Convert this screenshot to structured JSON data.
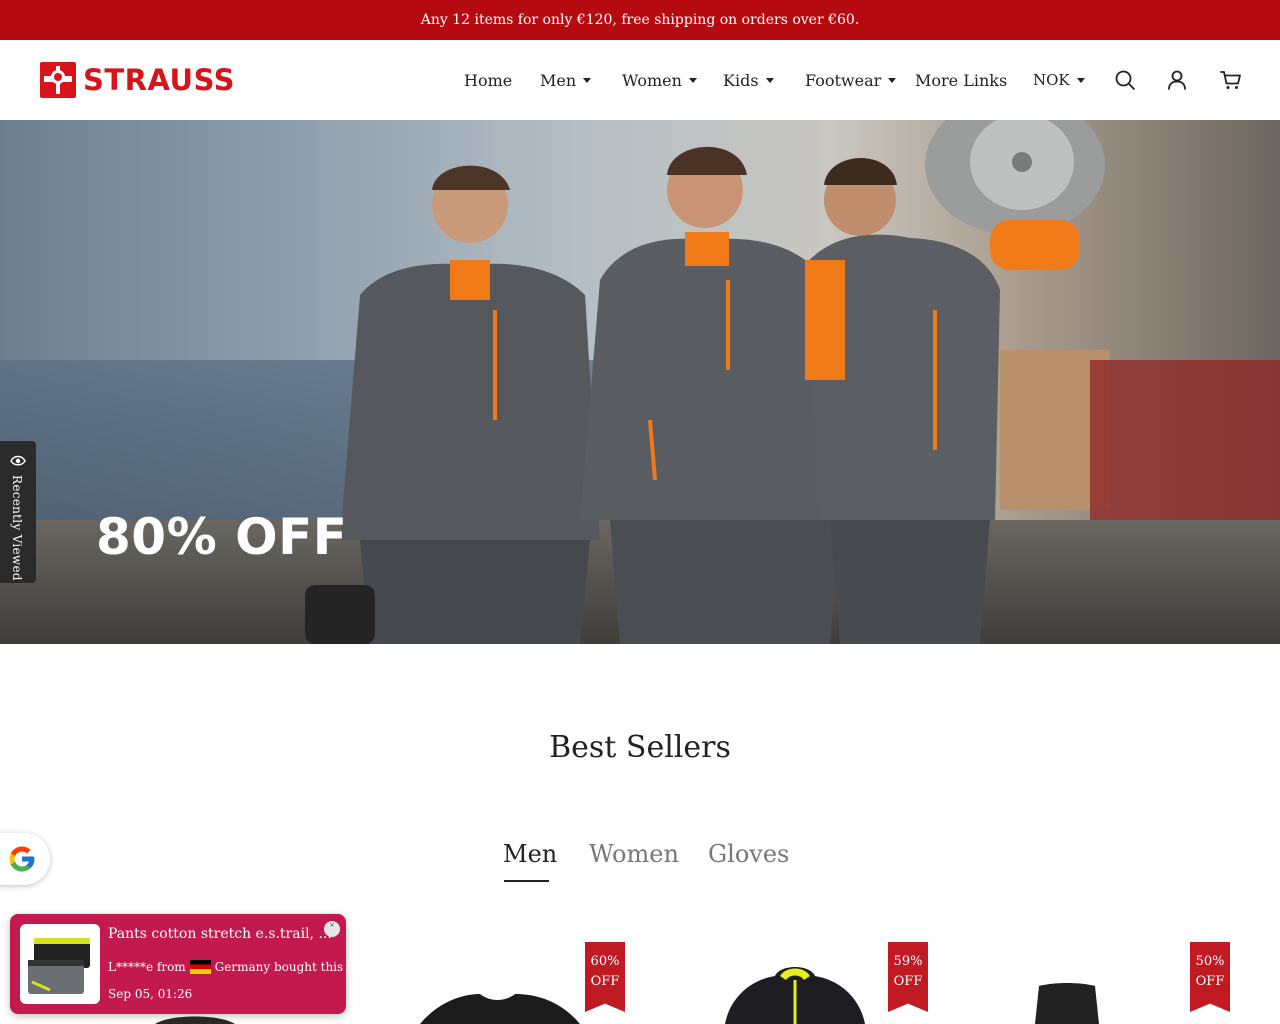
{
  "announcement": "Any 12 items for only €120, free shipping on orders over €60.",
  "brand": {
    "name": "STRAUSS",
    "color": "#d8141b"
  },
  "nav": {
    "items": [
      {
        "label": "Home",
        "has_dropdown": false
      },
      {
        "label": "Men",
        "has_dropdown": true
      },
      {
        "label": "Women",
        "has_dropdown": true
      },
      {
        "label": "Kids",
        "has_dropdown": true
      },
      {
        "label": "Footwear",
        "has_dropdown": true
      },
      {
        "label": "More Links",
        "has_dropdown": false
      }
    ],
    "currency": "NOK",
    "icons": [
      "search-icon",
      "account-icon",
      "cart-icon"
    ]
  },
  "hero": {
    "headline": "80% OFF"
  },
  "recently_viewed": {
    "label": "Recently Viewed"
  },
  "best_sellers": {
    "title": "Best Sellers",
    "tabs": [
      {
        "label": "Men",
        "active": true
      },
      {
        "label": "Women",
        "active": false
      },
      {
        "label": "Gloves",
        "active": false
      }
    ],
    "products": [
      {
        "discount_pct": "60%",
        "discount_suffix": "OFF"
      },
      {
        "discount_pct": "59%",
        "discount_suffix": "OFF"
      },
      {
        "discount_pct": "50%",
        "discount_suffix": "OFF"
      }
    ]
  },
  "purchase_popup": {
    "product": "Pants cotton stretch e.s.trail, ...",
    "buyer": "L*****e from",
    "country": "Germany bought this item",
    "time": "Sep 05, 01:26",
    "background": "#c21a4e"
  },
  "colors": {
    "announcement_bg": "#b50a0f",
    "discount_tag": "#c01b23"
  }
}
